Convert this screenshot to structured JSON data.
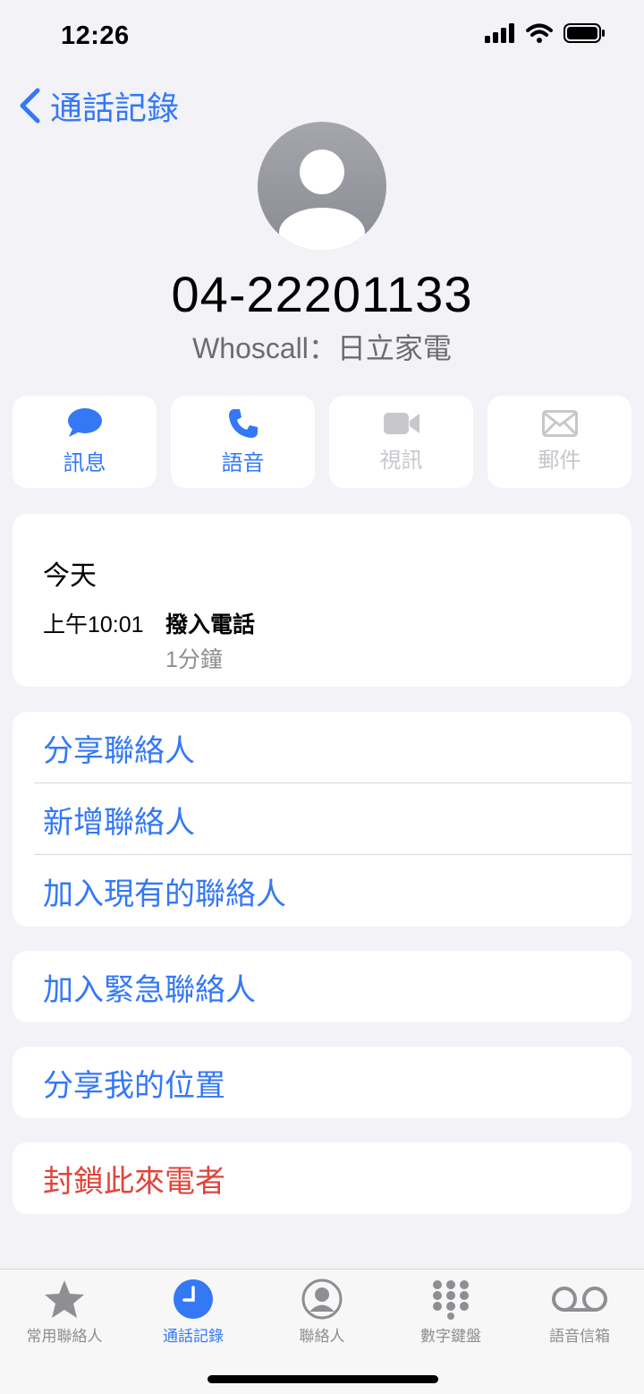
{
  "status_bar": {
    "time": "12:26"
  },
  "nav": {
    "back_label": "通話記錄"
  },
  "contact": {
    "phone_number": "04-22201133",
    "caller_id": "Whoscall：日立家電"
  },
  "actions": [
    {
      "label": "訊息",
      "icon": "message-icon",
      "enabled": true
    },
    {
      "label": "語音",
      "icon": "phone-icon",
      "enabled": true
    },
    {
      "label": "視訊",
      "icon": "video-icon",
      "enabled": false
    },
    {
      "label": "郵件",
      "icon": "mail-icon",
      "enabled": false
    }
  ],
  "recent_calls": {
    "day": "今天",
    "entries": [
      {
        "time": "上午10:01",
        "type": "撥入電話",
        "duration": "1分鐘"
      }
    ]
  },
  "contact_options": [
    "分享聯絡人",
    "新增聯絡人",
    "加入現有的聯絡人"
  ],
  "emergency": {
    "label": "加入緊急聯絡人"
  },
  "location": {
    "label": "分享我的位置"
  },
  "block": {
    "label": "封鎖此來電者"
  },
  "tabs": [
    {
      "label": "常用聯絡人",
      "icon": "star-icon",
      "active": false
    },
    {
      "label": "通話記錄",
      "icon": "clock-icon",
      "active": true
    },
    {
      "label": "聯絡人",
      "icon": "person-circle-icon",
      "active": false
    },
    {
      "label": "數字鍵盤",
      "icon": "keypad-icon",
      "active": false
    },
    {
      "label": "語音信箱",
      "icon": "voicemail-icon",
      "active": false
    }
  ],
  "colors": {
    "accent": "#3478f6",
    "danger": "#e0453b",
    "disabled": "#c7c7cc",
    "background": "#f2f2f7"
  }
}
